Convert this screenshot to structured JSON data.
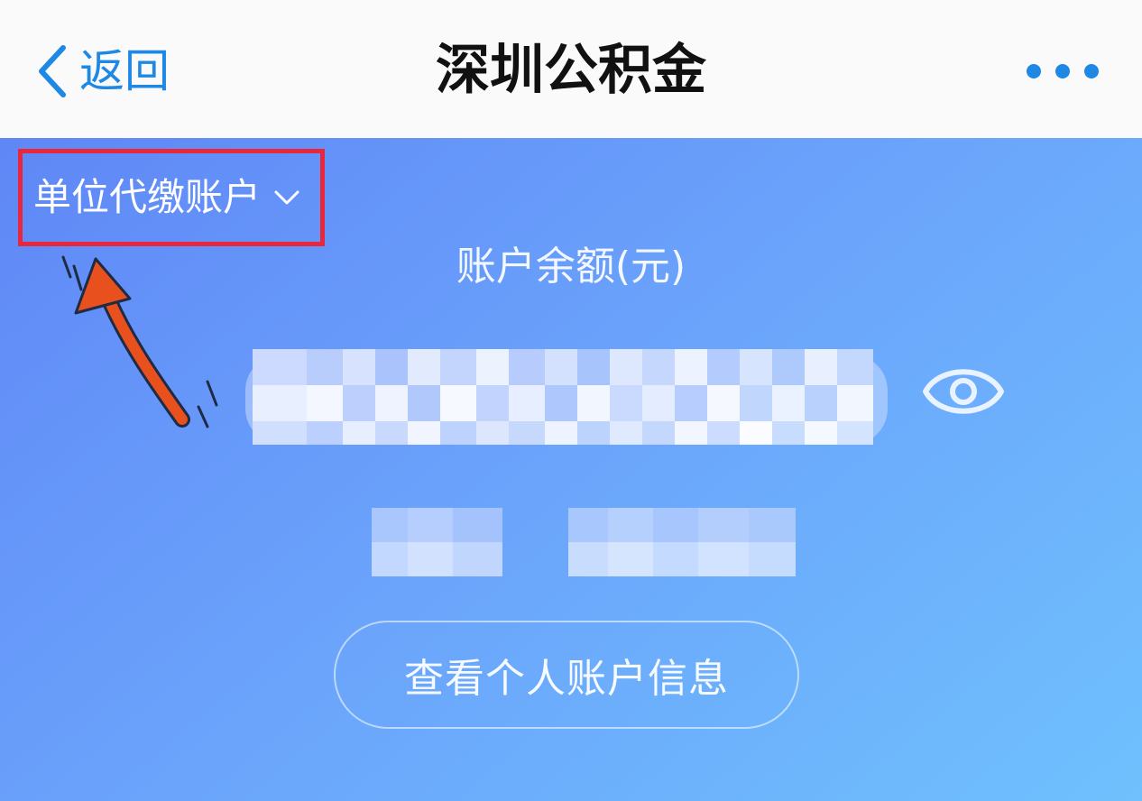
{
  "navbar": {
    "back_label": "返回",
    "title": "深圳公积金",
    "accent_color": "#1e88e5",
    "icons": {
      "back": "chevron-left-icon",
      "more": "more-dots-icon"
    }
  },
  "account": {
    "switch_label": "单位代缴账户",
    "switch_icon": "chevron-down-icon",
    "highlight_color": "#e8263c",
    "balance_label": "账户余额(元)",
    "balance_visibility_icon": "eye-icon"
  },
  "actions": {
    "view_personal_label": "查看个人账户信息"
  },
  "annotation": {
    "arrow_color": "#e8501e",
    "icon": "curved-arrow-icon"
  }
}
